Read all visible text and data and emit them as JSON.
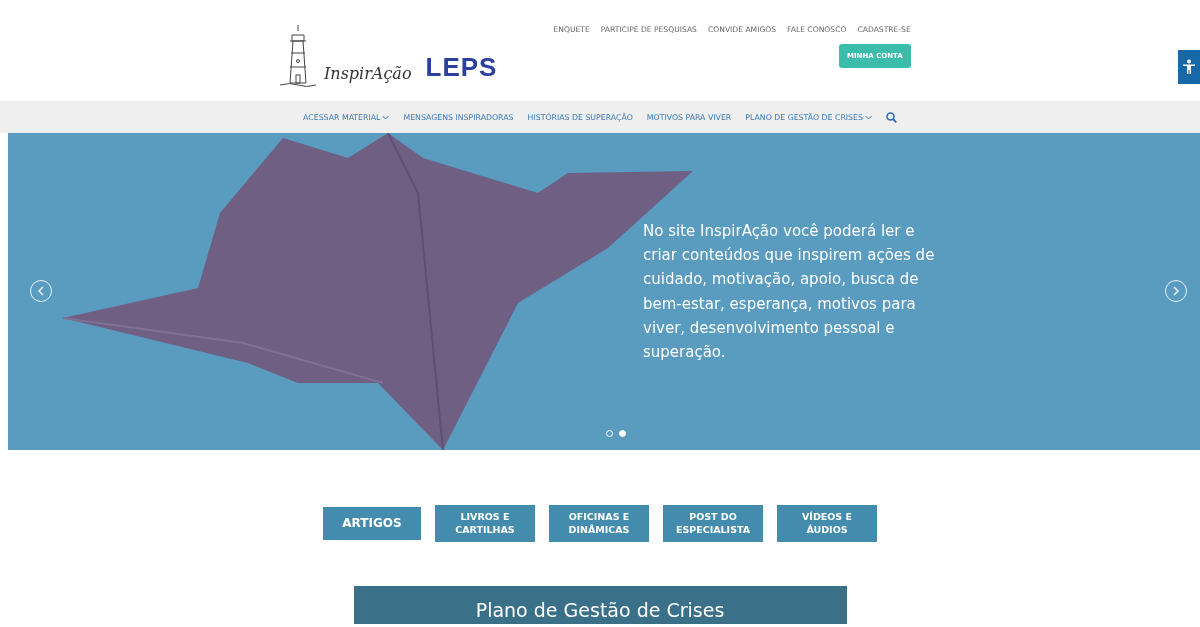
{
  "header": {
    "logo_text": "InspirAção",
    "partner_logo": "LEPS",
    "top_links": [
      "ENQUETE",
      "PARTICIPE DE PESQUISAS",
      "CONVIDE AMIGOS",
      "FALE CONOSCO",
      "CADASTRE-SE"
    ],
    "account_button": "MINHA CONTA"
  },
  "nav": {
    "items": [
      {
        "label": "ACESSAR MATERIAL",
        "dropdown": true
      },
      {
        "label": "MENSAGENS INSPIRADORAS",
        "dropdown": false
      },
      {
        "label": "HISTÓRIAS DE SUPERAÇÃO",
        "dropdown": false
      },
      {
        "label": "MOTIVOS PARA VIVER",
        "dropdown": false
      },
      {
        "label": "PLANO DE GESTÃO DE CRISES",
        "dropdown": true
      }
    ]
  },
  "hero": {
    "text": "No site InspirAção você poderá ler e criar conteúdos que inspirem ações de cuidado, motivação, apoio, busca de bem-estar, esperança, motivos para viver, desenvolvimento pessoal e superação.",
    "dots": [
      {
        "selected": false
      },
      {
        "selected": true
      }
    ]
  },
  "categories": [
    {
      "label": "ARTIGOS",
      "selected": true
    },
    {
      "label": "LIVROS E CARTILHAS",
      "selected": false
    },
    {
      "label": "OFICINAS E DINÂMICAS",
      "selected": false
    },
    {
      "label": "POST DO ESPECIALISTA",
      "selected": false
    },
    {
      "label": "VÍDEOS E ÁUDIOS",
      "selected": false
    }
  ],
  "feature_card": {
    "title": "Plano de Gestão de Crises"
  }
}
